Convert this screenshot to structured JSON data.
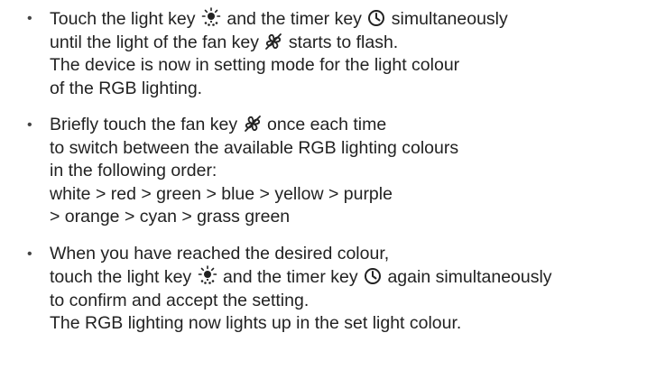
{
  "items": [
    {
      "bullet": "•",
      "l1_a": "Touch the light key",
      "l1_b": "and the timer key",
      "l1_c": "simultaneously",
      "l2_a": "until the light of the fan key",
      "l2_b": "starts to flash.",
      "l3": "The device is now in setting mode for the light colour",
      "l4": "of the RGB lighting."
    },
    {
      "bullet": "•",
      "l1_a": "Briefly touch the fan key",
      "l1_b": "once each time",
      "l2": "to switch between the available RGB lighting colours",
      "l3": "in the following order:",
      "l4": "white > red > green > blue > yellow > purple",
      "l5": "> orange > cyan > grass green"
    },
    {
      "bullet": "•",
      "l1": "When you have reached the desired colour,",
      "l2_a": "touch the light key",
      "l2_b": "and the timer key",
      "l2_c": "again simultaneously",
      "l3": "to confirm and accept the setting.",
      "l4": "The RGB lighting now lights up in the set light colour."
    }
  ],
  "icons": {
    "light": "light-bulb-rays-icon",
    "timer": "clock-icon",
    "fan": "fan-icon"
  }
}
